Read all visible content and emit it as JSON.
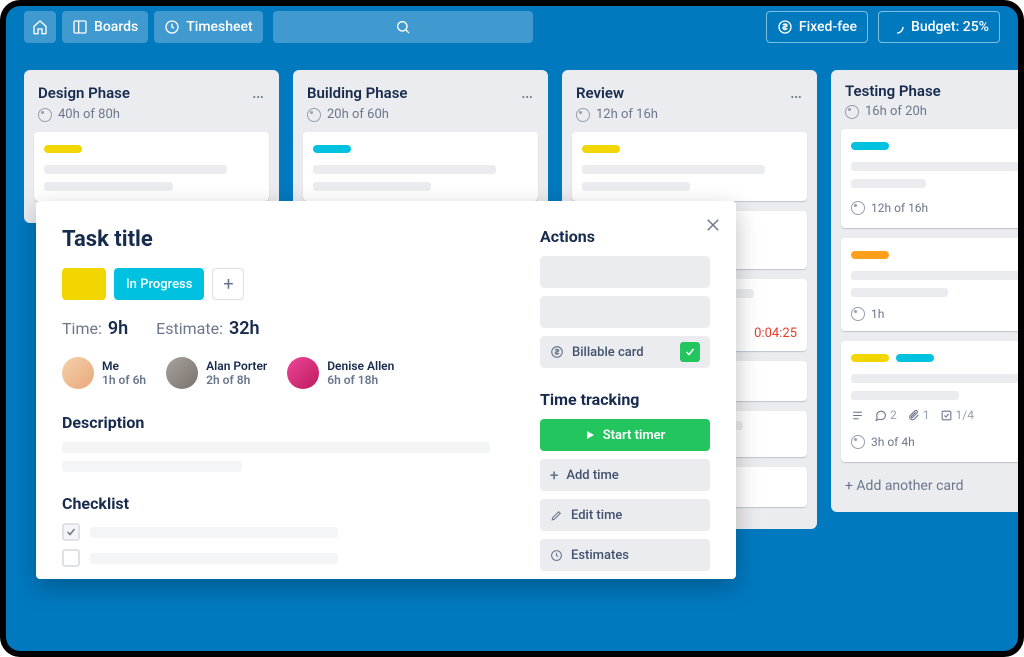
{
  "topbar": {
    "boards_label": "Boards",
    "timesheet_label": "Timesheet",
    "fixed_fee_label": "Fixed-fee",
    "budget_label": "Budget: 25%"
  },
  "columns": [
    {
      "title": "Design Phase",
      "hours": "40h of 80h",
      "labelColor": "yellow"
    },
    {
      "title": "Building Phase",
      "hours": "20h of 60h",
      "labelColor": "cyan"
    },
    {
      "title": "Review",
      "hours": "12h of 16h",
      "labelColor": "yellow"
    },
    {
      "title": "Testing Phase",
      "hours": "16h of 20h",
      "labelColor": "cyan"
    }
  ],
  "testing": {
    "card1_time": "12h of 16h",
    "card2_time": "1h",
    "card3_time": "3h of 4h",
    "card3_counts": {
      "comments": "2",
      "attachments": "1",
      "checklist": "1/4"
    },
    "add_label": "+ Add another card"
  },
  "review": {
    "running_timer": "0:04:25"
  },
  "modal": {
    "title": "Task title",
    "status": "In Progress",
    "time_label": "Time:",
    "time_value": "9h",
    "estimate_label": "Estimate:",
    "estimate_value": "32h",
    "assignees": [
      {
        "name": "Me",
        "time": "1h of 6h"
      },
      {
        "name": "Alan Porter",
        "time": "2h of 8h"
      },
      {
        "name": "Denise Allen",
        "time": "6h of 18h"
      }
    ],
    "description_title": "Description",
    "checklist_title": "Checklist",
    "actions_title": "Actions",
    "billable_label": "Billable card",
    "timetracking_title": "Time tracking",
    "start_timer": "Start timer",
    "add_time": "Add time",
    "edit_time": "Edit time",
    "estimates": "Estimates"
  }
}
